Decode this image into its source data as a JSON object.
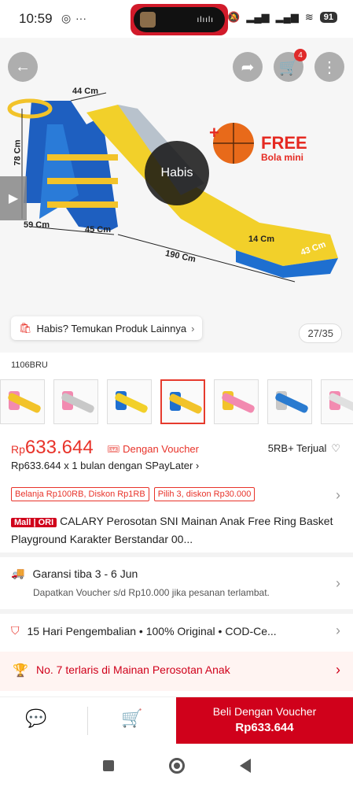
{
  "status": {
    "time": "10:59",
    "battery": "91",
    "left_icons": [
      "instagram-icon",
      "more-dots-icon"
    ],
    "right_icons": [
      "mute-icon",
      "signal-icon",
      "signal-icon",
      "wifi-icon"
    ]
  },
  "hero": {
    "cart_count": "4",
    "overlay_label": "Habis",
    "free_label": "FREE",
    "free_sub": "Bola mini",
    "dims": {
      "top": "44 Cm",
      "height": "78 Cm",
      "base_left": "59 Cm",
      "base_mid": "45 Cm",
      "length": "190 Cm",
      "slide_height": "14 Cm",
      "slide_width": "43 Cm"
    },
    "habis_link": "Habis? Temukan Produk Lainnya",
    "image_counter": "27/35"
  },
  "variant": {
    "code": "1106BRU",
    "thumbs": [
      {
        "slide": "#f2c32a",
        "frame": "#f28ab0"
      },
      {
        "slide": "#c8c8c8",
        "frame": "#f28ab0"
      },
      {
        "slide": "#f2d02a",
        "frame": "#1e6fd0"
      },
      {
        "slide": "#f2c32a",
        "frame": "#1e6fd0"
      },
      {
        "slide": "#f28ab0",
        "frame": "#f2c32a"
      },
      {
        "slide": "#2a7bd0",
        "frame": "#c8c8c8"
      },
      {
        "slide": "#e0e0e0",
        "frame": "#f28ab0"
      }
    ],
    "selected_index": 3
  },
  "price": {
    "currency": "Rp",
    "amount": "633.644",
    "voucher_label": "Dengan Voucher",
    "sold": "5RB+ Terjual",
    "paylater": "Rp633.644 x 1 bulan dengan SPayLater",
    "promos": [
      "Belanja Rp100RB, Diskon Rp1RB",
      "Pilih 3, diskon Rp30.000"
    ]
  },
  "product": {
    "mall_badge": "Mall | ORI",
    "title": "CALARY Perosotan SNI Mainan Anak Free Ring Basket Playground Karakter Berstandar 00..."
  },
  "shipping": {
    "title": "Garansi tiba 3 - 6 Jun",
    "sub": "Dapatkan Voucher s/d Rp10.000 jika pesanan terlambat."
  },
  "guarantee": {
    "text": "15 Hari Pengembalian • 100% Original • COD-Ce..."
  },
  "rank": {
    "text": "No. 7 terlaris di Mainan Perosotan Anak"
  },
  "bottom": {
    "buy_line1": "Beli Dengan Voucher",
    "buy_line2": "Rp633.644"
  },
  "colors": {
    "accent": "#e8332a",
    "buy_bg": "#d0011b"
  }
}
